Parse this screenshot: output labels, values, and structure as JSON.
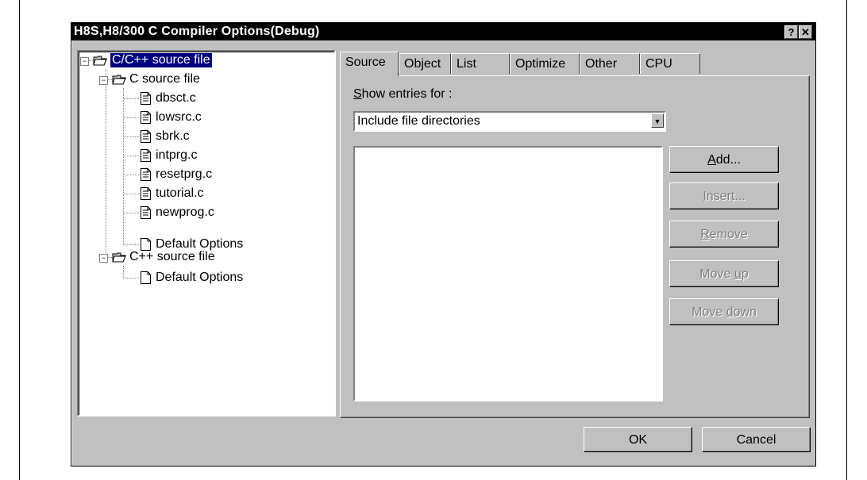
{
  "window": {
    "title": "H8S,H8/300 C Compiler Options(Debug)",
    "help_glyph": "?",
    "close_glyph": "✕"
  },
  "tree": {
    "root": "C/C++ source file",
    "c_group": "C source file",
    "c_files": [
      "dbsct.c",
      "lowsrc.c",
      "sbrk.c",
      "intprg.c",
      "resetprg.c",
      "tutorial.c",
      "newprog.c"
    ],
    "c_default": "Default Options",
    "cpp_group": "C++ source file",
    "cpp_default": "Default Options"
  },
  "tabs": [
    "Source",
    "Object",
    "List",
    "Optimize",
    "Other",
    "CPU"
  ],
  "source_tab": {
    "show_entries_label": "Show entries for :",
    "show_entries_value": "Include file directories",
    "buttons": {
      "add": "Add...",
      "insert": "Insert...",
      "remove": "Remove",
      "move_up": "Move up",
      "move_down": "Move down"
    }
  },
  "footer": {
    "ok": "OK",
    "cancel": "Cancel"
  },
  "colors": {
    "face": "#c0c0c0",
    "titlebar": "#000000",
    "selection": "#000080",
    "disabled_text": "#808080"
  }
}
